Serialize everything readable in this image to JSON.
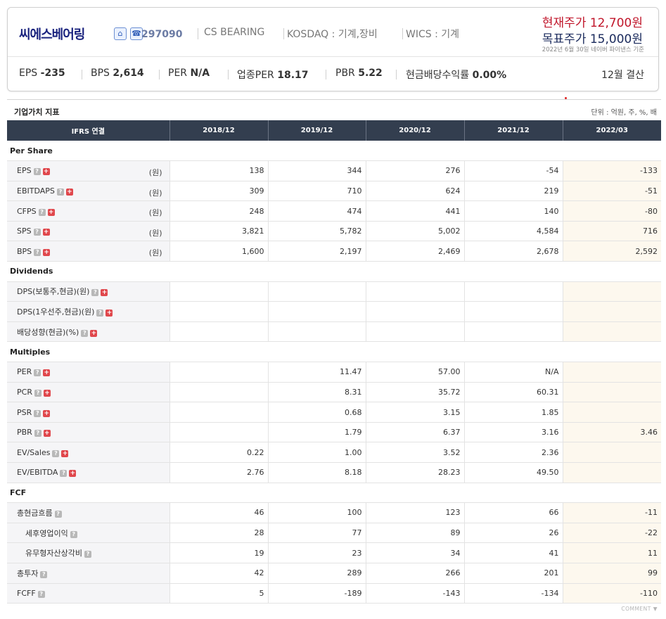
{
  "header": {
    "company_name": "씨에스베어링",
    "stock_code": "297090",
    "english_name": "CS BEARING",
    "market": "KOSDAQ : 기계,장비",
    "wics": "WICS : 기계",
    "current_price": "현재주가 12,700원",
    "target_price": "목표주가 15,000원",
    "price_note": "2022년 6월 30일 네이버 파이낸스 기준",
    "metrics": [
      {
        "label": "EPS",
        "value": "-235"
      },
      {
        "label": "BPS",
        "value": "2,614"
      },
      {
        "label": "PER",
        "value": "N/A"
      },
      {
        "label": "업종PER",
        "value": "18.17"
      },
      {
        "label": "PBR",
        "value": "5.22"
      },
      {
        "label": "현금배당수익률",
        "value": "0.00%"
      }
    ],
    "settlement": "12월 결산",
    "icons": [
      "home-icon",
      "phone-icon"
    ]
  },
  "section": {
    "title": "기업가치 지표",
    "unit_note": "단위 : 억원, 주, %, 배"
  },
  "table": {
    "headers": [
      "IFRS 연결",
      "2018/12",
      "2019/12",
      "2020/12",
      "2021/12",
      "2022/03"
    ],
    "groups": [
      {
        "name": "Per Share",
        "rows": [
          {
            "label": "EPS",
            "unit": "(원)",
            "plus": true,
            "values": [
              "138",
              "344",
              "276",
              "-54",
              "-133"
            ]
          },
          {
            "label": "EBITDAPS",
            "unit": "(원)",
            "plus": true,
            "values": [
              "309",
              "710",
              "624",
              "219",
              "-51"
            ]
          },
          {
            "label": "CFPS",
            "unit": "(원)",
            "plus": true,
            "values": [
              "248",
              "474",
              "441",
              "140",
              "-80"
            ]
          },
          {
            "label": "SPS",
            "unit": "(원)",
            "plus": true,
            "values": [
              "3,821",
              "5,782",
              "5,002",
              "4,584",
              "716"
            ]
          },
          {
            "label": "BPS",
            "unit": "(원)",
            "plus": true,
            "values": [
              "1,600",
              "2,197",
              "2,469",
              "2,678",
              "2,592"
            ]
          }
        ]
      },
      {
        "name": "Dividends",
        "rows": [
          {
            "label": "DPS(보통주,현금)(원)",
            "unit": "",
            "plus": true,
            "values": [
              "",
              "",
              "",
              "",
              ""
            ]
          },
          {
            "label": "DPS(1우선주,현금)(원)",
            "unit": "",
            "plus": true,
            "values": [
              "",
              "",
              "",
              "",
              ""
            ]
          },
          {
            "label": "배당성향(현금)(%)",
            "unit": "",
            "plus": true,
            "values": [
              "",
              "",
              "",
              "",
              ""
            ]
          }
        ]
      },
      {
        "name": "Multiples",
        "rows": [
          {
            "label": "PER",
            "unit": "",
            "plus": true,
            "values": [
              "",
              "11.47",
              "57.00",
              "N/A",
              ""
            ]
          },
          {
            "label": "PCR",
            "unit": "",
            "plus": true,
            "values": [
              "",
              "8.31",
              "35.72",
              "60.31",
              ""
            ]
          },
          {
            "label": "PSR",
            "unit": "",
            "plus": true,
            "values": [
              "",
              "0.68",
              "3.15",
              "1.85",
              ""
            ]
          },
          {
            "label": "PBR",
            "unit": "",
            "plus": true,
            "values": [
              "",
              "1.79",
              "6.37",
              "3.16",
              "3.46"
            ]
          },
          {
            "label": "EV/Sales",
            "unit": "",
            "plus": true,
            "values": [
              "0.22",
              "1.00",
              "3.52",
              "2.36",
              ""
            ]
          },
          {
            "label": "EV/EBITDA",
            "unit": "",
            "plus": true,
            "values": [
              "2.76",
              "8.18",
              "28.23",
              "49.50",
              ""
            ]
          }
        ]
      },
      {
        "name": "FCF",
        "rows": [
          {
            "label": "총현금흐름",
            "unit": "",
            "plus": false,
            "values": [
              "46",
              "100",
              "123",
              "66",
              "-11"
            ]
          },
          {
            "label": "세후영업이익",
            "unit": "",
            "plus": false,
            "sub": true,
            "values": [
              "28",
              "77",
              "89",
              "26",
              "-22"
            ]
          },
          {
            "label": "유무형자산상각비",
            "unit": "",
            "plus": false,
            "sub": true,
            "values": [
              "19",
              "23",
              "34",
              "41",
              "11"
            ]
          },
          {
            "label": "총투자",
            "unit": "",
            "plus": false,
            "values": [
              "42",
              "289",
              "266",
              "201",
              "99"
            ]
          },
          {
            "label": "FCFF",
            "unit": "",
            "plus": false,
            "values": [
              "5",
              "-189",
              "-143",
              "-134",
              "-110"
            ]
          }
        ]
      }
    ]
  },
  "footer": {
    "comment_label": "COMMENT ▼"
  },
  "colors": {
    "header_bg": "#333e4f",
    "negative": "#e0242f",
    "recent_col_bg": "#fdf8ee",
    "current_price": "#c0152a",
    "company_name": "#1a237e"
  }
}
